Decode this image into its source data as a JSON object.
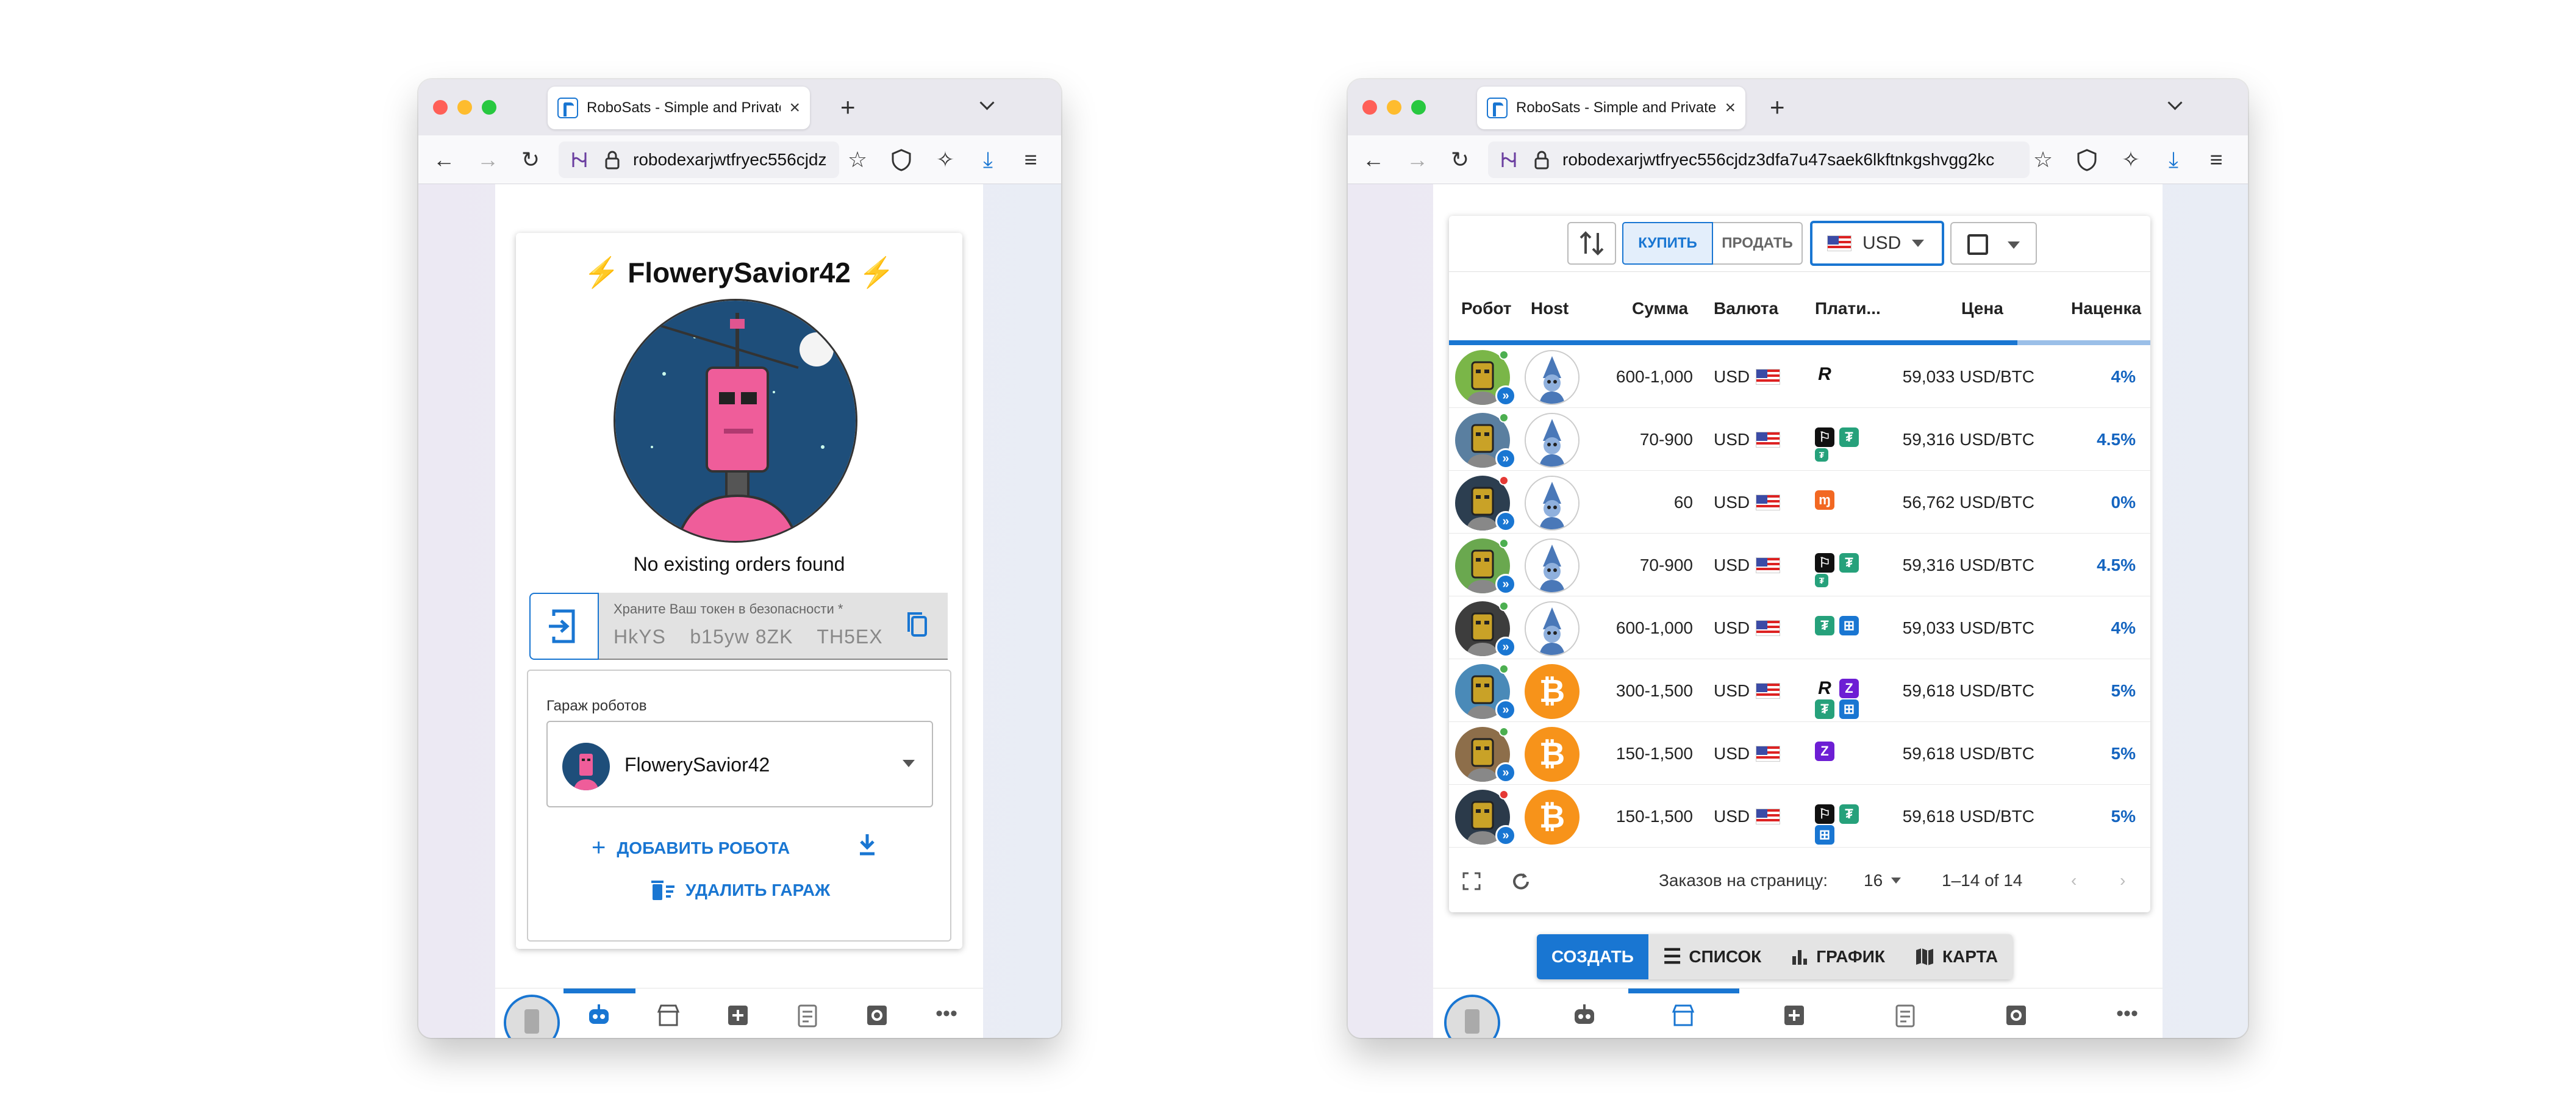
{
  "window1": {
    "tab_title": "RoboSats - Simple and Private B",
    "url": "robodexarjwtfryec556cjdz",
    "robot": {
      "name": "FlowerySavior42",
      "no_orders": "No existing orders found",
      "token_label": "Храните Ваш токен в безопасности *",
      "token_value": "HkYS    b15yw 8ZK    TH5EX"
    },
    "garage": {
      "label": "Гараж роботов",
      "selected": "FlowerySavior42",
      "add_robot": "ДОБАВИТЬ РОБОТА",
      "delete_garage": "УДАЛИТЬ ГАРАЖ"
    }
  },
  "window2": {
    "tab_title": "RoboSats - Simple and Private B",
    "url": "robodexarjwtfryec556cjdz3dfa7u47saek6lkftnkgshvgg2kc",
    "toolbar": {
      "buy": "КУПИТЬ",
      "sell": "ПРОДАТЬ",
      "currency": "USD"
    },
    "table": {
      "headers": [
        "Робот",
        "Host",
        "Сумма",
        "Валюта",
        "Плати...",
        "Цена",
        "Наценка"
      ],
      "rows": [
        {
          "amount": "600-1,000",
          "currency": "USD",
          "price": "59,033 USD/BTC",
          "premium": "4%",
          "robot_color": "#7ab648",
          "dot": "#4caf50",
          "host": "wizard",
          "methods": [
            "revolut"
          ]
        },
        {
          "amount": "70-900",
          "currency": "USD",
          "price": "59,316 USD/BTC",
          "premium": "4.5%",
          "robot_color": "#5a7fa0",
          "dot": "#4caf50",
          "host": "wizard",
          "methods": [
            "cashapp",
            "tether",
            "tether-small"
          ]
        },
        {
          "amount": "60",
          "currency": "USD",
          "price": "56,762 USD/BTC",
          "premium": "0%",
          "robot_color": "#2c3e50",
          "dot": "#e53935",
          "host": "wizard",
          "methods": [
            "monero"
          ]
        },
        {
          "amount": "70-900",
          "currency": "USD",
          "price": "59,316 USD/BTC",
          "premium": "4.5%",
          "robot_color": "#6aa84f",
          "dot": "#4caf50",
          "host": "wizard",
          "methods": [
            "cashapp",
            "tether",
            "tether-small"
          ]
        },
        {
          "amount": "600-1,000",
          "currency": "USD",
          "price": "59,033 USD/BTC",
          "premium": "4%",
          "robot_color": "#3d3d3d",
          "dot": "#4caf50",
          "host": "wizard",
          "methods": [
            "tether",
            "squares"
          ]
        },
        {
          "amount": "300-1,500",
          "currency": "USD",
          "price": "59,618 USD/BTC",
          "premium": "5%",
          "robot_color": "#4a8ab8",
          "dot": "#4caf50",
          "host": "btc",
          "methods": [
            "revolut",
            "zelle",
            "tether",
            "squares"
          ]
        },
        {
          "amount": "150-1,500",
          "currency": "USD",
          "price": "59,618 USD/BTC",
          "premium": "5%",
          "robot_color": "#8d6e4a",
          "dot": "#4caf50",
          "host": "btc",
          "methods": [
            "zelle"
          ]
        },
        {
          "amount": "150-1,500",
          "currency": "USD",
          "price": "59,618 USD/BTC",
          "premium": "5%",
          "robot_color": "#2b3a4a",
          "dot": "#e53935",
          "host": "btc",
          "methods": [
            "cashapp",
            "tether",
            "squares"
          ]
        }
      ]
    },
    "footer": {
      "per_page_label": "Заказов на страницу:",
      "per_page_value": "16",
      "range": "1–14 of 14"
    },
    "view_tabs": {
      "create": "СОЗДАТЬ",
      "list": "СПИСОК",
      "chart": "ГРАФИК",
      "map": "КАРТА"
    }
  },
  "colors": {
    "accent": "#1976d2",
    "bolt": "#f5b400",
    "btc_orange": "#f7931a"
  }
}
